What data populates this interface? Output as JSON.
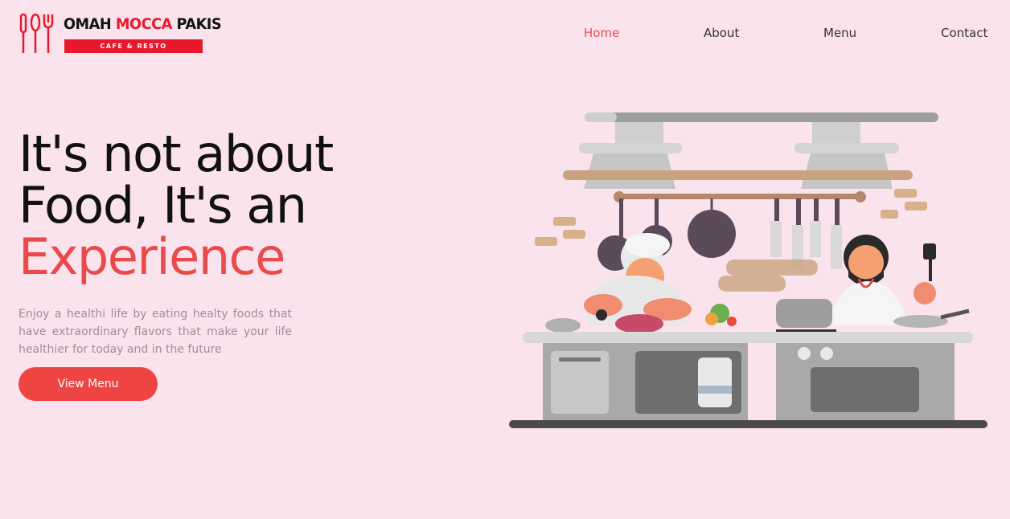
{
  "brand": {
    "name_part1": "OMAH",
    "name_part2": "MOCCA",
    "name_part3": "PAKIS",
    "tagline": "CAFE & RESTO",
    "accent_color": "#e8192c"
  },
  "nav": {
    "items": [
      {
        "label": "Home",
        "active": true
      },
      {
        "label": "About",
        "active": false
      },
      {
        "label": "Menu",
        "active": false
      },
      {
        "label": "Contact",
        "active": false
      }
    ]
  },
  "hero": {
    "headline_line1": "It's not about",
    "headline_line2": "Food, It's an",
    "headline_line3": "Experience",
    "description": "Enjoy a healthi life by eating healty foods that have extraordinary flavors that make your life healthier for today and in the future",
    "cta_label": "View Menu",
    "accent_color": "#ef4444"
  },
  "colors": {
    "background": "#fbe3ee"
  },
  "illustration": {
    "icon": "kitchen-chefs-illustration"
  }
}
